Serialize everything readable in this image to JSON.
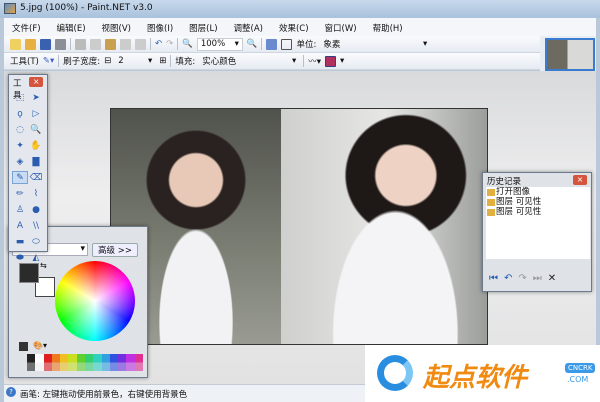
{
  "window": {
    "title": "5.jpg (100%) - Paint.NET v3.0"
  },
  "menu": [
    "文件(F)",
    "编辑(E)",
    "视图(V)",
    "图像(I)",
    "图层(L)",
    "调整(A)",
    "效果(C)",
    "窗口(W)",
    "帮助(H)"
  ],
  "toolbar1": {
    "zoom": "100%",
    "unit_label": "单位:",
    "unit_value": "象素"
  },
  "toolbar2": {
    "tools_label": "工具(T)",
    "brush_width_label": "刷子宽度:",
    "brush_width": "2",
    "fill_label": "填充:",
    "fill_value": "实心颜色"
  },
  "tools_window": {
    "title": "工具",
    "icons": [
      "rect-select",
      "move-selection",
      "lasso",
      "move-selected",
      "ellipse-select",
      "zoom",
      "magic-wand",
      "pan",
      "paint-bucket",
      "gradient",
      "paintbrush",
      "eraser",
      "pencil",
      "color-picker",
      "clone-stamp",
      "recolor",
      "text",
      "line-curve",
      "rectangle",
      "rounded-rectangle",
      "ellipse",
      "freeform-shape"
    ],
    "selected": "paintbrush"
  },
  "colors_window": {
    "more_button": "高级 >>",
    "primary_color": "#2b2b2b",
    "secondary_color": "#ffffff",
    "palette": [
      "#222222",
      "#ffffff",
      "#e02020",
      "#f07a20",
      "#f0c020",
      "#c8e020",
      "#60d030",
      "#30d070",
      "#30d0c0",
      "#30a0e0",
      "#3050e0",
      "#7030e0",
      "#c030e0",
      "#e03090"
    ]
  },
  "history_window": {
    "title": "历史记录",
    "items": [
      "打开图像",
      "图层 可见性",
      "图层 可见性"
    ]
  },
  "status": {
    "text": "画笔: 左键拖动使用前景色，右键使用背景色"
  },
  "watermark": {
    "text": "起点软件",
    "badge": "CNCRK",
    ".com": ".COM"
  }
}
